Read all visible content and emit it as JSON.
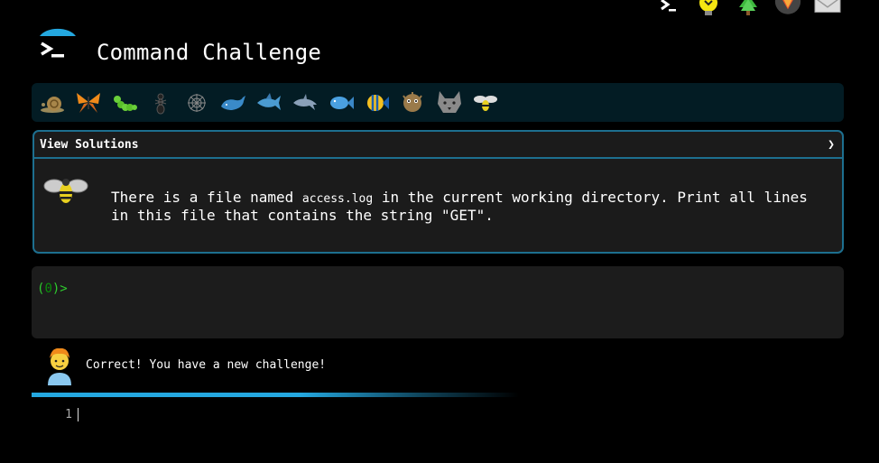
{
  "header": {
    "title": "Command Challenge",
    "top_icons": [
      "terminal-icon",
      "idea-bulb-icon",
      "tree-icon",
      "fox-icon",
      "mail-icon"
    ]
  },
  "levels": [
    {
      "icon": "snail-icon"
    },
    {
      "icon": "butterfly-icon"
    },
    {
      "icon": "caterpillar-icon"
    },
    {
      "icon": "ant-icon"
    },
    {
      "icon": "spider-web-icon"
    },
    {
      "icon": "whale-icon"
    },
    {
      "icon": "shark-icon"
    },
    {
      "icon": "dolphin-icon"
    },
    {
      "icon": "fish-icon"
    },
    {
      "icon": "tropical-fish-icon"
    },
    {
      "icon": "pufferfish-icon"
    },
    {
      "icon": "wolf-icon"
    },
    {
      "icon": "bee-icon"
    }
  ],
  "solutions": {
    "label": "View Solutions",
    "chevron": "❯"
  },
  "challenge": {
    "text_before": "There is a file named ",
    "filename": "access.log",
    "text_after": " in the current working directory. Print all lines in this file that contains the string \"GET\"."
  },
  "terminal": {
    "prompt_open": "(",
    "prompt_count": "0",
    "prompt_close": ")>"
  },
  "feedback": {
    "message": "Correct! You have a new challenge!"
  },
  "progress": {
    "fraction": 0.55
  },
  "editor": {
    "line_number": "1"
  },
  "colors": {
    "accent": "#24a8e0",
    "border": "#1d6f8f",
    "prompt": "#2ecc2e"
  }
}
